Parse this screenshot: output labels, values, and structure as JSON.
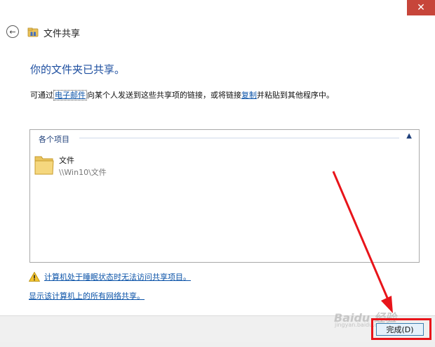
{
  "window": {
    "close_glyph": "✕",
    "title": "文件共享",
    "back_icon": "back-arrow-icon",
    "folder_icon": "folder-share-icon"
  },
  "main": {
    "headline": "你的文件夹已共享。",
    "desc_prefix": "可通过",
    "desc_email_link": "电子邮件",
    "desc_middle": "向某个人发送到这些共享项的链接，或将链接",
    "desc_copy_link": "复制",
    "desc_suffix": "并粘贴到其他程序中。"
  },
  "items": {
    "group_label": "各个项目",
    "group_chevron": "▲",
    "list": [
      {
        "name": "文件",
        "path": "\\\\Win10\\文件"
      }
    ]
  },
  "links": {
    "warning_text": "计算机处于睡眠状态时无法访问共享项目。",
    "network_shares": "显示该计算机上的所有网络共享。"
  },
  "footer": {
    "done_label": "完成(D)"
  },
  "watermark": {
    "brand": "Baidu 经验",
    "sub": "jingyan.baidu.com"
  },
  "colors": {
    "accent": "#1e4fa0",
    "link": "#0b53a8",
    "annotation_red": "#e8141a"
  }
}
